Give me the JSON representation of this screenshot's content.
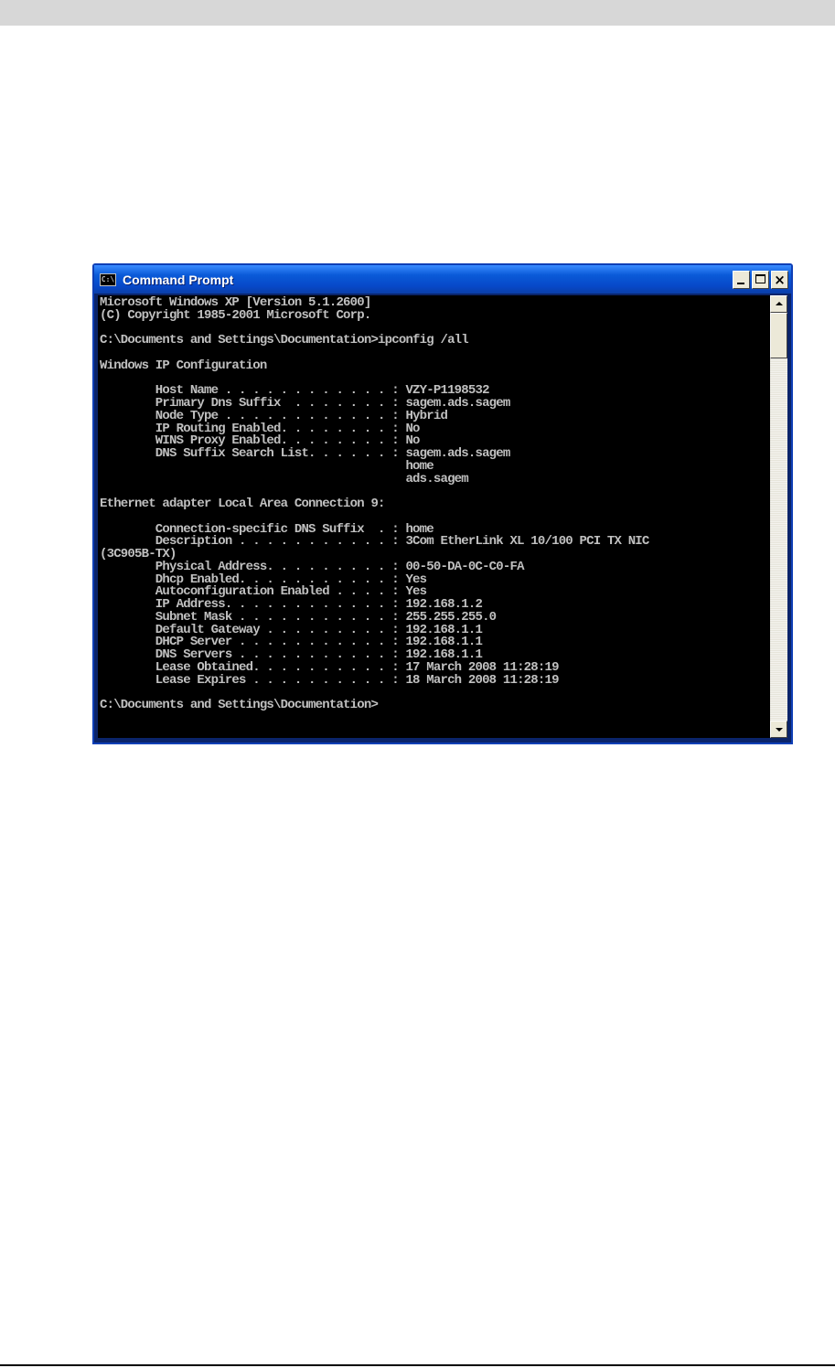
{
  "window": {
    "title": "Command Prompt",
    "icon": "cmd-icon",
    "icon_glyph": "C:\\",
    "controls": {
      "minimize": "minimize-icon",
      "maximize": "maximize-icon",
      "close": "close-icon",
      "close_glyph": "×"
    }
  },
  "console": {
    "lines": [
      "Microsoft Windows XP [Version 5.1.2600]",
      "(C) Copyright 1985-2001 Microsoft Corp.",
      "",
      "C:\\Documents and Settings\\Documentation>ipconfig /all",
      "",
      "Windows IP Configuration",
      "",
      "        Host Name . . . . . . . . . . . . : VZY-P1198532",
      "        Primary Dns Suffix  . . . . . . . : sagem.ads.sagem",
      "        Node Type . . . . . . . . . . . . : Hybrid",
      "        IP Routing Enabled. . . . . . . . : No",
      "        WINS Proxy Enabled. . . . . . . . : No",
      "        DNS Suffix Search List. . . . . . : sagem.ads.sagem",
      "                                            home",
      "                                            ads.sagem",
      "",
      "Ethernet adapter Local Area Connection 9:",
      "",
      "        Connection-specific DNS Suffix  . : home",
      "        Description . . . . . . . . . . . : 3Com EtherLink XL 10/100 PCI TX NIC",
      "(3C905B-TX)",
      "        Physical Address. . . . . . . . . : 00-50-DA-0C-C0-FA",
      "        Dhcp Enabled. . . . . . . . . . . : Yes",
      "        Autoconfiguration Enabled . . . . : Yes",
      "        IP Address. . . . . . . . . . . . : 192.168.1.2",
      "        Subnet Mask . . . . . . . . . . . : 255.255.255.0",
      "        Default Gateway . . . . . . . . . : 192.168.1.1",
      "        DHCP Server . . . . . . . . . . . : 192.168.1.1",
      "        DNS Servers . . . . . . . . . . . : 192.168.1.1",
      "        Lease Obtained. . . . . . . . . . : 17 March 2008 11:28:19",
      "        Lease Expires . . . . . . . . . . : 18 March 2008 11:28:19",
      "",
      "C:\\Documents and Settings\\Documentation>"
    ]
  },
  "scrollbar": {
    "up": "scroll-up-arrow-icon",
    "down": "scroll-down-arrow-icon"
  },
  "colors": {
    "titlebar": "#0a5ad8",
    "console_bg": "#000000",
    "console_fg": "#c0c0c0",
    "page_band": "#d7d7d7"
  }
}
